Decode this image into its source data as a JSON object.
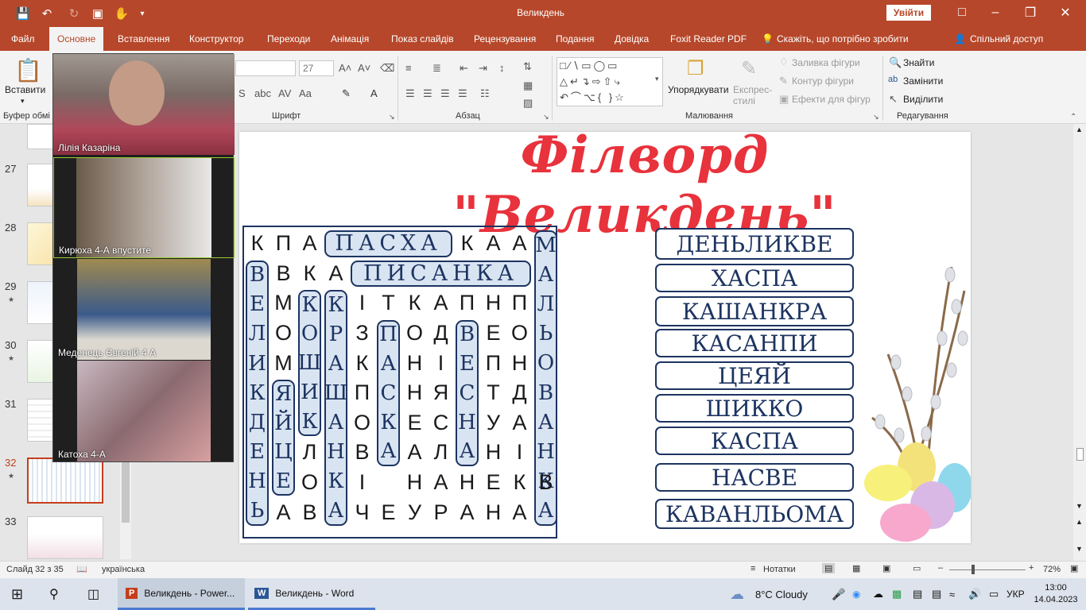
{
  "app": {
    "title": "Великдень",
    "signin_label": "Увійти",
    "colors": {
      "accent": "#b7472a",
      "slide_title": "#e8323c",
      "navy": "#1d3461"
    }
  },
  "quick_access": [
    "save-icon",
    "undo-icon",
    "redo-icon",
    "present-icon",
    "touch-icon",
    "customize-icon"
  ],
  "tabs": [
    "Файл",
    "Основне",
    "Вставлення",
    "Конструктор",
    "Переходи",
    "Анімація",
    "Показ слайдів",
    "Рецензування",
    "Подання",
    "Довідка",
    "Foxit Reader PDF",
    "Скажіть, що потрібно зробити",
    "Спільний доступ"
  ],
  "active_tab": "Основне",
  "ribbon": {
    "paste_label": "Вставити",
    "clipboard_group": "Буфер обмі",
    "font_group": "Шрифт",
    "font_size": "27",
    "paragraph_group": "Абзац",
    "drawing_group": "Малювання",
    "arrange_label": "Упорядкувати",
    "quick_styles_label": "Експрес-стилі",
    "fill_label": "Заливка фігури",
    "outline_label": "Контур фігури",
    "effects_label": "Ефекти для фігур",
    "editing_group": "Редагування",
    "find_label": "Знайти",
    "replace_label": "Замінити",
    "select_label": "Виділити"
  },
  "slides": [
    {
      "number": "27",
      "star": false
    },
    {
      "number": "28",
      "star": false
    },
    {
      "number": "29",
      "star": true
    },
    {
      "number": "30",
      "star": true
    },
    {
      "number": "31",
      "star": false
    },
    {
      "number": "32",
      "star": true,
      "selected": true
    },
    {
      "number": "33",
      "star": false
    }
  ],
  "video": {
    "participants": [
      "Лілія Казаріна",
      "Кирюха 4-А впустите",
      "Меденець Євгеній 4 А",
      "Катоха 4-А"
    ]
  },
  "slide": {
    "title": "Філворд \"Великдень\"",
    "grid": [
      [
        "К",
        "П",
        "А",
        "",
        "",
        "",
        "",
        "",
        "К",
        "А",
        "А",
        ""
      ],
      [
        "",
        "В",
        "К",
        "А",
        "",
        "",
        "",
        "",
        "",
        "",
        "",
        ""
      ],
      [
        "",
        "М",
        "",
        "",
        "І",
        "Т",
        "К",
        "А",
        "П",
        "Н",
        "П",
        ""
      ],
      [
        "",
        "О",
        "",
        "",
        "З",
        "",
        "О",
        "Д",
        "",
        "Е",
        "О",
        ""
      ],
      [
        "",
        "М",
        "",
        "",
        "К",
        "",
        "Н",
        "І",
        "",
        "П",
        "Н",
        ""
      ],
      [
        "",
        "",
        "",
        "",
        "П",
        "",
        "Н",
        "Я",
        "",
        "Т",
        "Д",
        ""
      ],
      [
        "",
        "",
        "",
        "",
        "О",
        "",
        "Е",
        "С",
        "",
        "У",
        "А",
        ""
      ],
      [
        "",
        "",
        "Л",
        "",
        "В",
        "",
        "А",
        "Л",
        "",
        "Н",
        "І",
        ""
      ],
      [
        "",
        "",
        "О",
        "",
        "І",
        "",
        "Н",
        "А",
        "Н",
        "Е",
        "К",
        "В"
      ],
      [
        "",
        "А",
        "В",
        "",
        "Ч",
        "Е",
        "У",
        "Р",
        "А",
        "Н",
        "А",
        ""
      ]
    ],
    "found_words": {
      "pasha_h": "ПАСХА",
      "pysanka_h": "ПИСАНКА",
      "velykden_v": "ВЕЛИКДЕНЬ",
      "yaytse_v": "ЯЙЦЕ",
      "koshyk_v": "КОШИК",
      "krashanka_v": "КРАШАНКА",
      "paska_v": "ПАСКА",
      "vesna_v": "ВЕСНА",
      "malyovanka_v": "МАЛЬОВАНКА"
    },
    "anagrams": [
      "ДЕНЬЛИКВЕ",
      "ХАСПА",
      "КАШАНКРА",
      "КАСАНПИ",
      "ЦЕЯЙ",
      "ШИККО",
      "КАСПА",
      "НАСВЕ",
      "КАВАНЛЬОМА"
    ]
  },
  "status": {
    "slide_info": "Слайд 32 з 35",
    "language": "українська",
    "notes_label": "Нотатки",
    "zoom": "72%"
  },
  "taskbar": {
    "ppt_label": "Великдень - Power...",
    "word_label": "Великдень - Word",
    "weather": "8°C  Cloudy",
    "lang": "УКР",
    "time": "13:00",
    "date": "14.04.2023"
  }
}
